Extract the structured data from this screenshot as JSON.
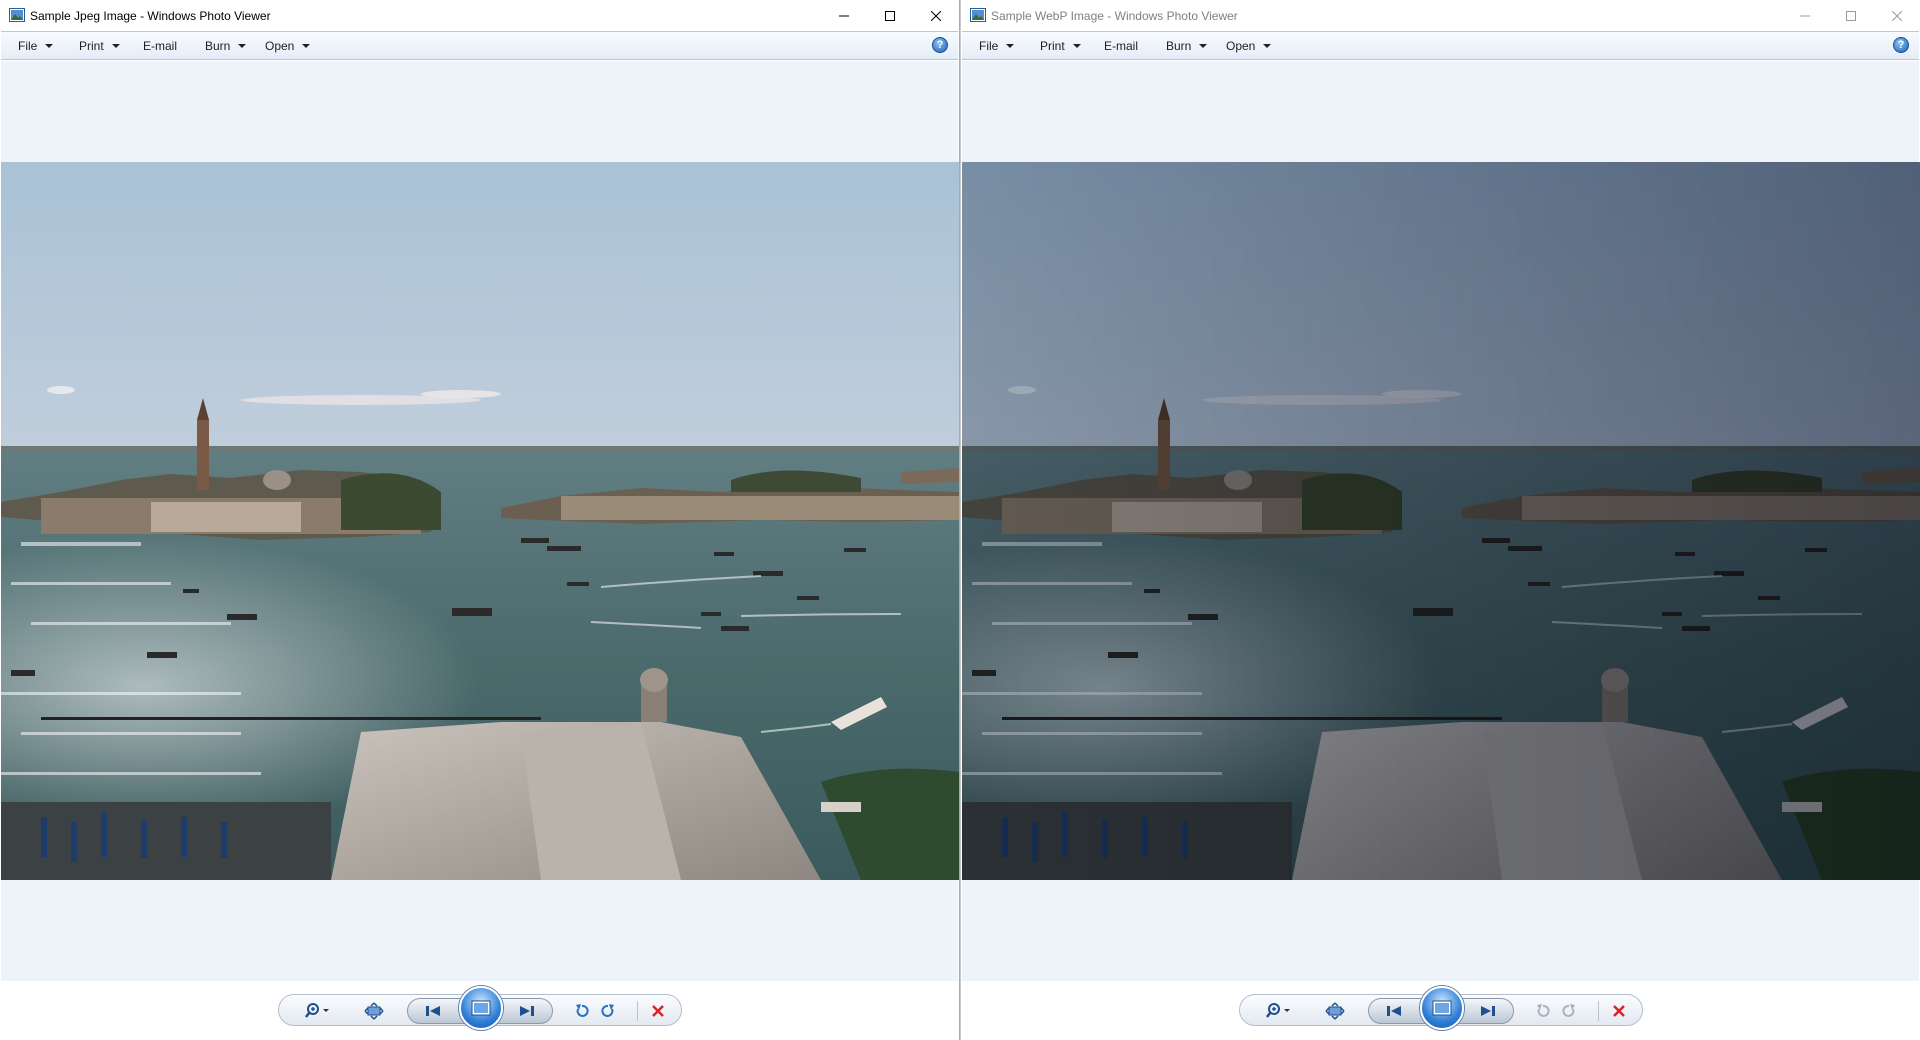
{
  "windows": [
    {
      "title": "Sample Jpeg Image - Windows Photo Viewer",
      "menu": [
        {
          "label": "File",
          "has_dropdown": true
        },
        {
          "label": "Print",
          "has_dropdown": true
        },
        {
          "label": "E-mail",
          "has_dropdown": false
        },
        {
          "label": "Burn",
          "has_dropdown": true
        },
        {
          "label": "Open",
          "has_dropdown": true
        }
      ],
      "help_label": "?",
      "photo_tone": "normal",
      "focused": true,
      "rotate_enabled": true
    },
    {
      "title": "Sample WebP Image - Windows Photo Viewer",
      "menu": [
        {
          "label": "File",
          "has_dropdown": true
        },
        {
          "label": "Print",
          "has_dropdown": true
        },
        {
          "label": "E-mail",
          "has_dropdown": false
        },
        {
          "label": "Burn",
          "has_dropdown": true
        },
        {
          "label": "Open",
          "has_dropdown": true
        }
      ],
      "help_label": "?",
      "photo_tone": "dark",
      "focused": false,
      "rotate_enabled": false
    }
  ],
  "icons": {
    "app": "photo-viewer-icon",
    "minimize": "minimize-icon",
    "maximize": "maximize-icon",
    "close": "close-icon",
    "help": "help-icon",
    "zoom": "zoom-icon",
    "actual_size": "actual-size-icon",
    "previous": "previous-icon",
    "slideshow": "slideshow-icon",
    "next": "next-icon",
    "rotate_ccw": "rotate-counterclockwise-icon",
    "rotate_cw": "rotate-clockwise-icon",
    "delete": "delete-icon"
  },
  "colors": {
    "viewer_background": "#eef3fa",
    "menubar_top": "#f8fbfe",
    "menubar_bottom": "#e4edf7",
    "delete_red": "#d9232a",
    "rotate_blue": "#2b6fc2"
  }
}
